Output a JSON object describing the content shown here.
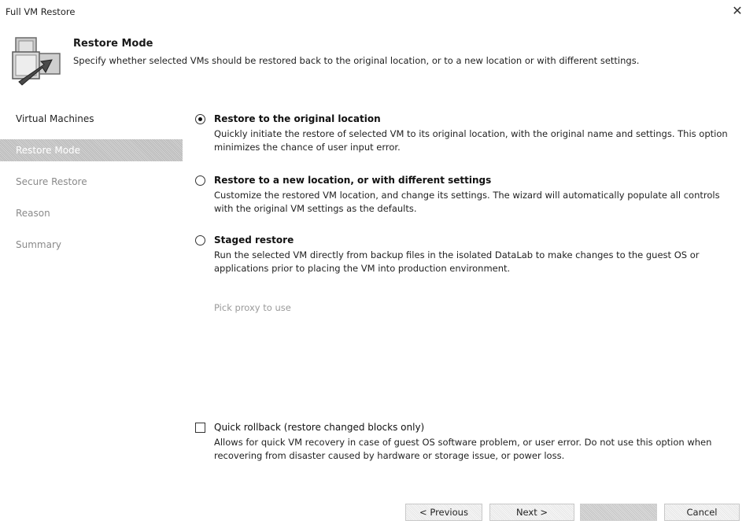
{
  "window": {
    "title": "Full VM Restore",
    "close_icon": "close-icon"
  },
  "header": {
    "icon": "vm-restore-icon",
    "title": "Restore Mode",
    "subtitle": "Specify whether selected VMs should be restored back to the original location, or to a new location or with different settings."
  },
  "sidebar": {
    "items": [
      {
        "label": "Virtual Machines",
        "state": "completed"
      },
      {
        "label": "Restore Mode",
        "state": "active"
      },
      {
        "label": "Secure Restore",
        "state": "pending"
      },
      {
        "label": "Reason",
        "state": "pending"
      },
      {
        "label": "Summary",
        "state": "pending"
      }
    ]
  },
  "options": [
    {
      "label": "Restore to the original location",
      "description": "Quickly initiate the restore of selected VM to its original location, with the original name and settings. This option minimizes the chance of user input error.",
      "selected": true
    },
    {
      "label": "Restore to a new location, or with different settings",
      "description": "Customize the restored VM location, and change its settings. The wizard will automatically populate all controls with the original VM settings as the defaults.",
      "selected": false
    },
    {
      "label": "Staged restore",
      "description": "Run the selected VM directly from backup files in the isolated DataLab to make changes to the guest OS or applications prior to placing the VM into production environment.",
      "selected": false
    }
  ],
  "proxy_link": "Pick proxy to use",
  "quick_rollback": {
    "label": "Quick rollback (restore changed blocks only)",
    "description": "Allows for quick VM recovery in case of guest OS software problem, or user error. Do not use this option when recovering from disaster caused by hardware or storage issue, or power loss.",
    "checked": false
  },
  "footer": {
    "previous": "< Previous",
    "next": "Next >",
    "finish": "",
    "cancel": "Cancel"
  }
}
